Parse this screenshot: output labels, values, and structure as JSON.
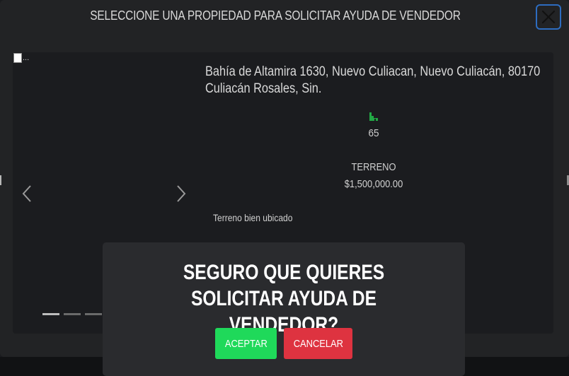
{
  "modal": {
    "title": "SELECCIONE UNA PROPIEDAD PARA SOLICITAR AYUDA DE VENDEDOR",
    "close_icon": "close-icon"
  },
  "property": {
    "image_alt": "...",
    "address_line1": "Bahía de Altamira 1630, Nuevo Culiacan, Nuevo Culiacán, 80170",
    "address_line2": "Culiacán Rosales, Sin.",
    "size_icon": "area-icon",
    "size_value": "65",
    "type": "TERRENO",
    "price": "$1,500,000.00",
    "description": "Terreno bien ubicado",
    "carousel": {
      "slide_count": 3,
      "active_index": 0
    }
  },
  "confirm": {
    "question": "SEGURO QUE QUIERES SOLICITAR AYUDA DE VENDEDOR?",
    "accept_label": "ACEPTAR",
    "cancel_label": "CANCELAR"
  },
  "colors": {
    "accent_green": "#1fd95a",
    "danger_red": "#de3340",
    "focus_blue": "#2d6cc0",
    "icon_green": "#22a845"
  }
}
